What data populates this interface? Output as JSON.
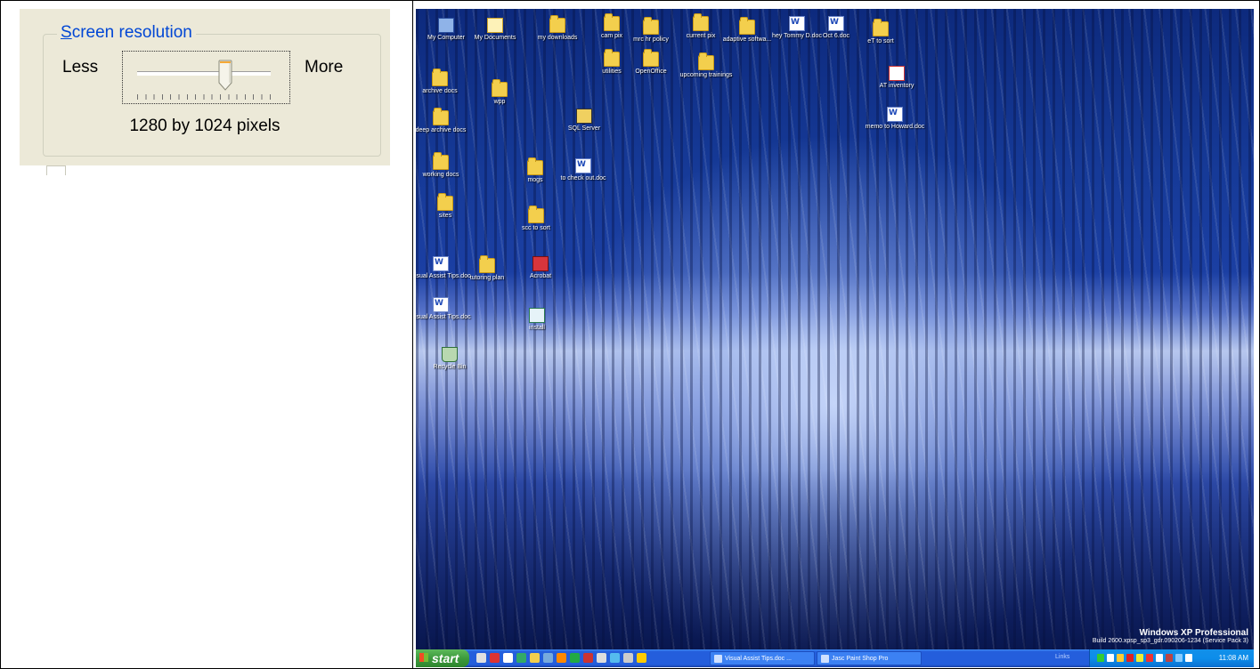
{
  "resolution_panel": {
    "legend": "Screen resolution",
    "less_label": "Less",
    "more_label": "More",
    "value_text": "1280 by 1024 pixels",
    "slider_level_fraction": 0.66
  },
  "desktop": {
    "icons": [
      {
        "label": "My Computer",
        "icon": "my-computer-icon"
      },
      {
        "label": "My Documents",
        "icon": "my-documents-icon"
      },
      {
        "label": "my downloads",
        "icon": "folder-icon"
      },
      {
        "label": "cam pix",
        "icon": "folder-icon"
      },
      {
        "label": "mrc hr policy",
        "icon": "folder-icon"
      },
      {
        "label": "current pix",
        "icon": "folder-icon"
      },
      {
        "label": "adaptive softwa...",
        "icon": "folder-icon"
      },
      {
        "label": "hey Tommy D.doc",
        "icon": "word-doc-icon"
      },
      {
        "label": "Oct 6.doc",
        "icon": "word-doc-icon"
      },
      {
        "label": "eT to sort",
        "icon": "folder-icon"
      },
      {
        "label": "utilities",
        "icon": "folder-icon"
      },
      {
        "label": "OpenOffice",
        "icon": "folder-icon"
      },
      {
        "label": "upcoming trainings",
        "icon": "folder-icon"
      },
      {
        "label": "AT inventory",
        "icon": "pdf-doc-icon"
      },
      {
        "label": "archive docs",
        "icon": "folder-icon"
      },
      {
        "label": "wpp",
        "icon": "folder-icon"
      },
      {
        "label": "SQL Server",
        "icon": "sql-server-icon"
      },
      {
        "label": "memo to Howard.doc",
        "icon": "word-doc-icon"
      },
      {
        "label": "deep archive docs",
        "icon": "folder-icon"
      },
      {
        "label": "working docs",
        "icon": "folder-icon"
      },
      {
        "label": "mogs",
        "icon": "folder-icon"
      },
      {
        "label": "to check out.doc",
        "icon": "word-doc-icon"
      },
      {
        "label": "sites",
        "icon": "folder-icon"
      },
      {
        "label": "scc to sort",
        "icon": "folder-icon"
      },
      {
        "label": "Visual Assist Tips.doc",
        "icon": "word-doc-icon"
      },
      {
        "label": "tutoring plan",
        "icon": "folder-icon"
      },
      {
        "label": "Acrobat",
        "icon": "app-shortcut-icon"
      },
      {
        "label": "Visual Assist Tips.doc",
        "icon": "word-doc-icon"
      },
      {
        "label": "install",
        "icon": "installer-icon"
      },
      {
        "label": "Recycle Bin",
        "icon": "recycle-bin-icon"
      }
    ],
    "os_brand": "Windows XP Professional",
    "os_build": "Build 2600.xpsp_sp3_gdr.090206-1234 (Service Pack 3)"
  },
  "taskbar": {
    "start_label": "start",
    "buttons": [
      {
        "label": "Visual Assist Tips.doc ..."
      },
      {
        "label": "Jasc Paint Shop Pro"
      }
    ],
    "links_label": "Links",
    "clock": "11:08 AM"
  }
}
